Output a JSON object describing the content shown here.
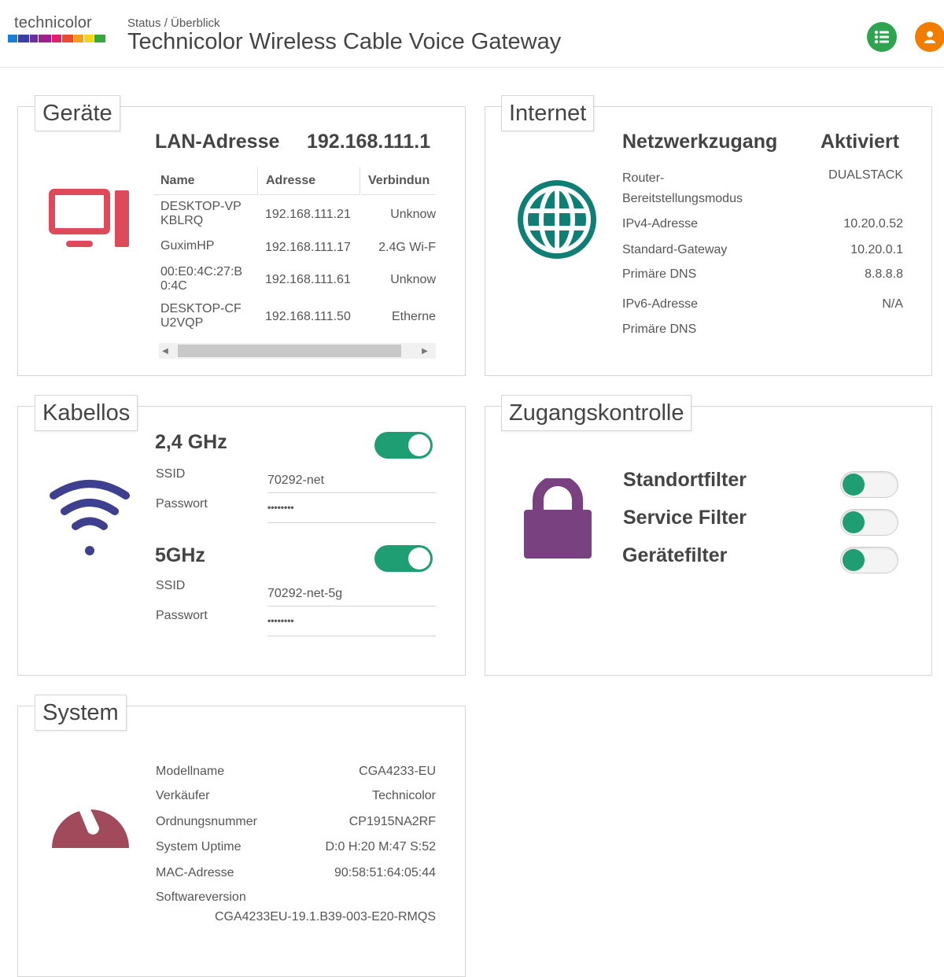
{
  "header": {
    "logo_text": "technicolor",
    "breadcrumb": "Status / Überblick",
    "title": "Technicolor Wireless Cable Voice Gateway",
    "list_icon": "list-icon",
    "user_icon": "user-icon"
  },
  "colors": {
    "green": "#2fa44f",
    "orange": "#f07d00",
    "devices_red": "#df4a5b",
    "internet_teal": "#0f7e74",
    "wifi_indigo": "#3e3f8e",
    "lock_purple": "#7a4180",
    "system_maroon": "#a14a5c",
    "toggle_green": "#1f9d73"
  },
  "devices": {
    "title": "Geräte",
    "icon": "monitor-icon",
    "lan_label": "LAN-Adresse",
    "lan_value": "192.168.111.1",
    "columns": [
      "Name",
      "Adresse",
      "Verbindun"
    ],
    "rows": [
      {
        "name1": "DESKTOP-VP",
        "name2": "KBLRQ",
        "address": "192.168.111.21",
        "conn": "Unknow"
      },
      {
        "name1": "GuximHP",
        "name2": "",
        "address": "192.168.111.17",
        "conn": "2.4G Wi-F"
      },
      {
        "name1": "00:E0:4C:27:B",
        "name2": "0:4C",
        "address": "192.168.111.61",
        "conn": "Unknow"
      },
      {
        "name1": "DESKTOP-CF",
        "name2": "U2VQP",
        "address": "192.168.111.50",
        "conn": "Etherne"
      }
    ]
  },
  "internet": {
    "title": "Internet",
    "icon": "globe-icon",
    "access_label": "Netzwerkzugang",
    "access_value": "Aktiviert",
    "mode_label_1": "Router-",
    "mode_label_2": "Bereitstellungsmodus",
    "mode_value": "DUALSTACK",
    "ipv4_label": "IPv4-Adresse",
    "ipv4_value": "10.20.0.52",
    "gateway_label": "Standard-Gateway",
    "gateway_value": "10.20.0.1",
    "dns_label": "Primäre DNS",
    "dns_value": "8.8.8.8",
    "ipv6_label": "IPv6-Adresse",
    "ipv6_value": "N/A",
    "dns6_label": "Primäre DNS"
  },
  "wireless": {
    "title": "Kabellos",
    "icon": "wifi-icon",
    "band24": {
      "label": "2,4 GHz",
      "ssid_label": "SSID",
      "ssid": "70292-net",
      "pass_label": "Passwort",
      "pass": "••••••••",
      "enabled": true
    },
    "band5": {
      "label": "5GHz",
      "ssid_label": "SSID",
      "ssid": "70292-net-5g",
      "pass_label": "Passwort",
      "pass": "••••••••",
      "enabled": true
    }
  },
  "access": {
    "title": "Zugangskontrolle",
    "icon": "lock-icon",
    "items": [
      {
        "label": "Standortfilter",
        "enabled": false
      },
      {
        "label": "Service Filter",
        "enabled": false
      },
      {
        "label": "Gerätefilter",
        "enabled": false
      }
    ]
  },
  "system": {
    "title": "System",
    "icon": "gauge-icon",
    "rows": [
      {
        "label": "Modellname",
        "value": "CGA4233-EU"
      },
      {
        "label": "Verkäufer",
        "value": "Technicolor"
      },
      {
        "label": "Ordnungsnummer",
        "value": "CP1915NA2RF"
      },
      {
        "label": "System Uptime",
        "value": "D:0 H:20 M:47 S:52"
      },
      {
        "label": "MAC-Adresse",
        "value": "90:58:51:64:05:44"
      }
    ],
    "sw_label": "Softwareversion",
    "sw_value": "CGA4233EU-19.1.B39-003-E20-RMQS"
  }
}
